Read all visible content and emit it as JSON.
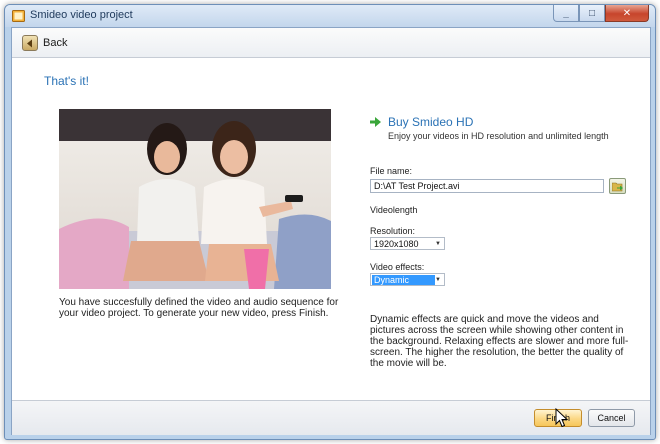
{
  "window": {
    "title": "Smideo video project"
  },
  "topbar": {
    "back_label": "Back"
  },
  "main": {
    "heading": "That's it!",
    "description": "You have succesfully defined the video and audio sequence for your video project. To generate your new video, press Finish."
  },
  "buy": {
    "title": "Buy Smideo HD",
    "subtitle": "Enjoy your videos in HD resolution and unlimited length"
  },
  "form": {
    "file_name_label": "File name:",
    "file_name_value": "D:\\AT Test Project.avi",
    "videolength_label": "Videolength",
    "resolution_label": "Resolution:",
    "resolution_value": "1920x1080",
    "effects_label": "Video effects:",
    "effects_value": "Dynamic"
  },
  "note": "Dynamic effects are quick and move the videos and pictures across the screen while showing other content in the background. Relaxing effects are slower and more full-screen. The higher the resolution, the better the quality of the movie will be.",
  "footer": {
    "finish_label": "Finish",
    "cancel_label": "Cancel"
  },
  "icons": {
    "app": "app-icon",
    "back": "back-arrow-icon",
    "buy": "green-arrow-icon",
    "browse": "browse-folder-icon",
    "dropdown": "chevron-down-icon",
    "cursor": "mouse-pointer-icon"
  },
  "colors": {
    "accent_text": "#2a72b5",
    "selection": "#3399ff",
    "finish_button": "#fbd784"
  }
}
